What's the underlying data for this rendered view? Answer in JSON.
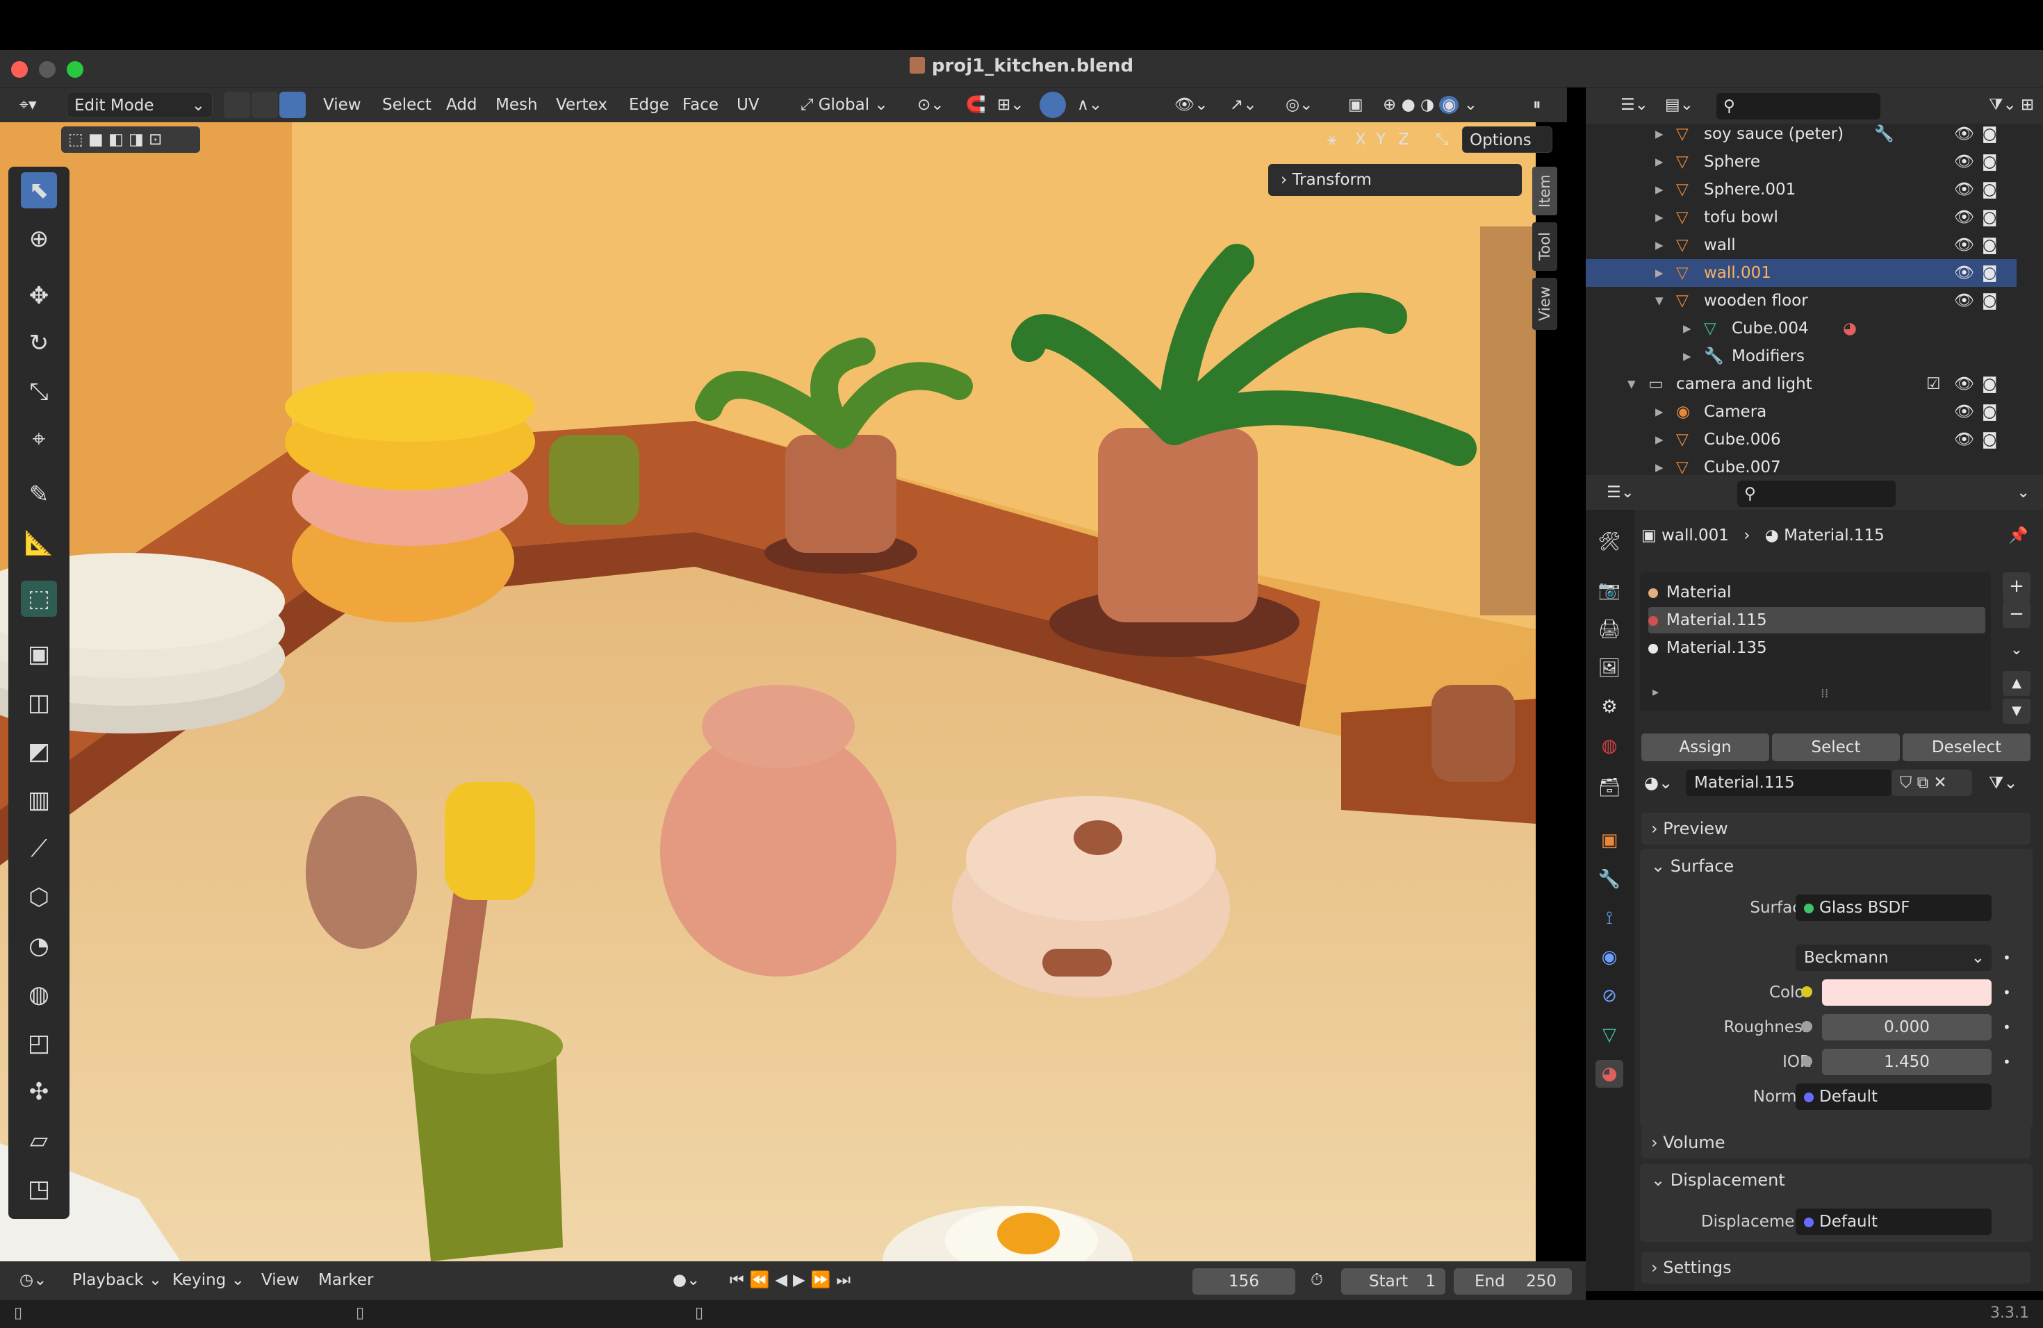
{
  "window": {
    "title": "proj1_kitchen.blend"
  },
  "viewport_header": {
    "mode": "Edit Mode",
    "menus": [
      "View",
      "Select",
      "Add",
      "Mesh",
      "Vertex",
      "Edge",
      "Face",
      "UV"
    ],
    "orientation": "Global",
    "options_label": "Options",
    "axes": [
      "X",
      "Y",
      "Z"
    ]
  },
  "sidebar_panel": {
    "transform_label": "Transform",
    "tabs": [
      "Item",
      "Tool",
      "View"
    ]
  },
  "outliner": {
    "rows": [
      {
        "label": "soy sauce (peter)"
      },
      {
        "label": "Sphere"
      },
      {
        "label": "Sphere.001"
      },
      {
        "label": "tofu bowl"
      },
      {
        "label": "wall"
      },
      {
        "label": "wall.001",
        "selected": true
      },
      {
        "label": "wooden floor"
      },
      {
        "label": "Cube.004"
      },
      {
        "label": "Modifiers"
      },
      {
        "label": "camera and light"
      },
      {
        "label": "Camera"
      },
      {
        "label": "Cube.006"
      },
      {
        "label": "Cube.007"
      }
    ]
  },
  "properties": {
    "breadcrumb": {
      "object": "wall.001",
      "material": "Material.115"
    },
    "slots": [
      "Material",
      "Material.115",
      "Material.135"
    ],
    "slot_buttons": {
      "assign": "Assign",
      "select": "Select",
      "deselect": "Deselect"
    },
    "material_name": "Material.115",
    "sections": {
      "preview": "Preview",
      "surface": "Surface",
      "volume": "Volume",
      "displacement": "Displacement",
      "settings": "Settings"
    },
    "surface": {
      "surface_label": "Surface",
      "surface_value": "Glass BSDF",
      "distribution": "Beckmann",
      "color_label": "Color",
      "color_value": "#fde0de",
      "roughness_label": "Roughness",
      "roughness_value": "0.000",
      "ior_label": "IOR",
      "ior_value": "1.450",
      "normal_label": "Normal",
      "normal_value": "Default"
    },
    "displacement": {
      "label": "Displacement",
      "value": "Default"
    }
  },
  "timeline": {
    "menus": [
      "Playback",
      "Keying",
      "View",
      "Marker"
    ],
    "current_frame": "156",
    "start_label": "Start",
    "start_value": "1",
    "end_label": "End",
    "end_value": "250"
  },
  "status": {
    "version": "3.3.1"
  },
  "colors": {
    "accent": "#4772b3",
    "selected_row": "#334d80",
    "outliner_orange": "#e8883a",
    "mesh_green": "#3fc2a0"
  }
}
